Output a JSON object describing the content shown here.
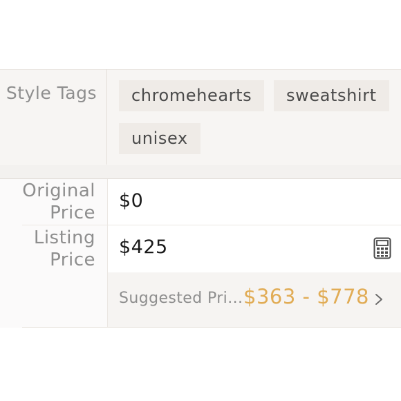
{
  "style_tags": {
    "label": "Style Tags",
    "tags": [
      "chromehearts",
      "sweatshirt",
      "unisex"
    ]
  },
  "original_price": {
    "label_line1": "Original",
    "label_line2": "Price",
    "value": "$0"
  },
  "listing_price": {
    "label_line1": "Listing",
    "label_line2": "Price",
    "value": "$425",
    "calculator_icon": "calculator-icon"
  },
  "suggested_price": {
    "label": "Suggested Pri...",
    "range": "$363 - $778",
    "chevron_icon": "chevron-right-icon"
  },
  "colors": {
    "accent": "#e1ac55",
    "label_gray": "#8e8e8e",
    "tag_bg": "#efebe7"
  }
}
